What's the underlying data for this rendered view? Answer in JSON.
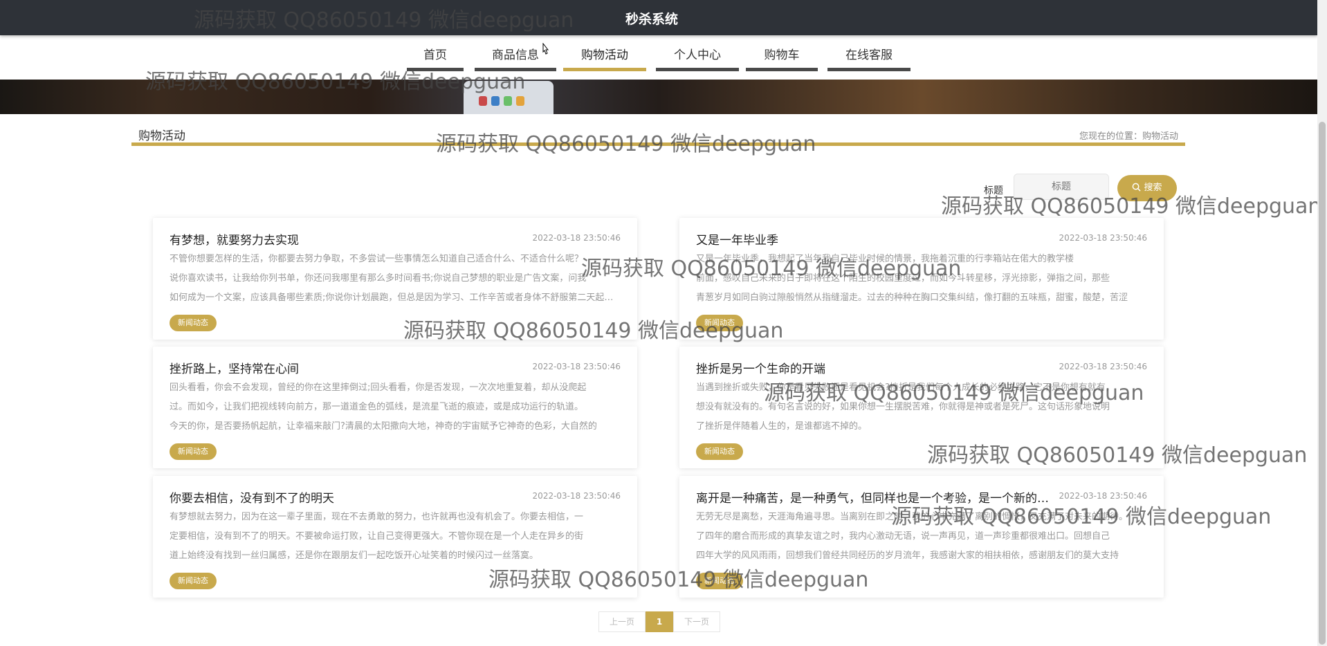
{
  "header": {
    "title": "秒杀系统"
  },
  "nav": {
    "items": [
      {
        "label": "首页"
      },
      {
        "label": "商品信息"
      },
      {
        "label": "购物活动"
      },
      {
        "label": "个人中心"
      },
      {
        "label": "购物车"
      },
      {
        "label": "在线客服"
      }
    ],
    "active": "购物活动"
  },
  "section": {
    "title": "购物活动",
    "location": "您现在的位置：购物活动"
  },
  "search": {
    "label": "标题",
    "placeholder": "标题",
    "button_label": "搜索"
  },
  "news": [
    {
      "title": "有梦想，就要努力去实现",
      "date": "2022-03-18 23:50:46",
      "lines": [
        "不管你想要怎样的生活，你都要去努力争取，不多尝试一些事情怎么知道自己适合什么、不适合什么呢？",
        "说你喜欢读书，让我给你列书单，你还问我哪里有那么多时间看书;你说自己梦想的职业是广告文案，问我",
        "如何成为一个文案，应该具备哪些素质;你说你计划晨跑，但总是因为学习、工作辛苦或者身体不舒服第二天起不来"
      ],
      "tag": "新闻动态"
    },
    {
      "title": "又是一年毕业季",
      "date": "2022-03-18 23:50:46",
      "lines": [
        "又是一年毕业季，我想起了当年我自己毕业时候的情景，我拖着沉重的行李箱站在偌大的教学楼",
        "前面，感叹自己未来的日子即将在这个陌生的校园里度过，而如今斗转星移，浮光掠影，弹指之间，那些",
        "青葱岁月如同白驹过隙般悄然从指缝溜走。过去的种种在胸口交集纠结，像打翻的五味瓶，甜蜜，酸楚，苦涩"
      ],
      "tag": "新闻动态"
    },
    {
      "title": "挫折路上，坚持常在心间",
      "date": "2022-03-18 23:50:46",
      "lines": [
        "回头看看，你会不会发现，曾经的你在这里摔倒过;回头看看，你是否发现，一次次地重复着，却从没爬起",
        "过。而如今，让我们把视线转向前方，那一道道金色的弧线，是流星飞逝的痕迹，或是成功运行的轨道。",
        "今天的你，是否要扬帆起航，让幸福来敲门?清晨的太阳撒向大地，神奇的宇宙赋予它神奇的色彩，大自然的"
      ],
      "tag": "新闻动态"
    },
    {
      "title": "挫折是另一个生命的开端",
      "date": "2022-03-18 23:50:46",
      "lines": [
        "当遇到挫折或失败，你是看见失败还是看见机会?挫折是我们每个人成长的必经之路，它不是你想有就有，",
        "想没有就没有的。有句名言说的好，如果你想一生摆脱苦难，你就得是神或者是死尸。这句话形象地说明",
        "了挫折是伴随着人生的，是谁都逃不掉的。"
      ],
      "tag": "新闻动态"
    },
    {
      "title": "你要去相信，没有到不了的明天",
      "date": "2022-03-18 23:50:46",
      "lines": [
        "有梦想就去努力，因为在这一辈子里面，现在不去勇敢的努力，也许就再也没有机会了。你要去相信，一",
        "定要相信，没有到不了的明天。不要被命运打败，让自己变得更强大。不管你现在是一个人走在异乡的街",
        "道上始终没有找到一丝归属感，还是你在跟朋友们一起吃饭开心址笑着的时候闪过一丝落寞。"
      ],
      "tag": "新闻动态"
    },
    {
      "title": "离开是一种痛苦，是一种勇气，但同样也是一个考验，是一个新的开始",
      "date": "2022-03-18 23:50:46",
      "lines": [
        "无劳无尽是离愁，天涯海角遍寻思。当离别在即之时，我的心中充满了离别的惆怅，又充满了对未来的期待。",
        "了四年的磨合而形成的真挚友谊之时，我内心激动无语，说一声再见，道一声珍重都很难出口。回想自己",
        "四年大学的风风雨雨，回想我们曾经共同经历的岁月流年，我感谢大家的相扶相依，感谢朋友们的莫大支持"
      ],
      "tag": "新闻动态"
    }
  ],
  "pagination": {
    "prev_label": "上一页",
    "current": "1",
    "next_label": "下一页"
  },
  "watermark": {
    "text": "源码获取 QQ86050149 微信deepguan"
  },
  "colors": {
    "accent": "#c8a94c",
    "topbar": "#2e3238",
    "nav_underline": "#4a4a4a"
  }
}
